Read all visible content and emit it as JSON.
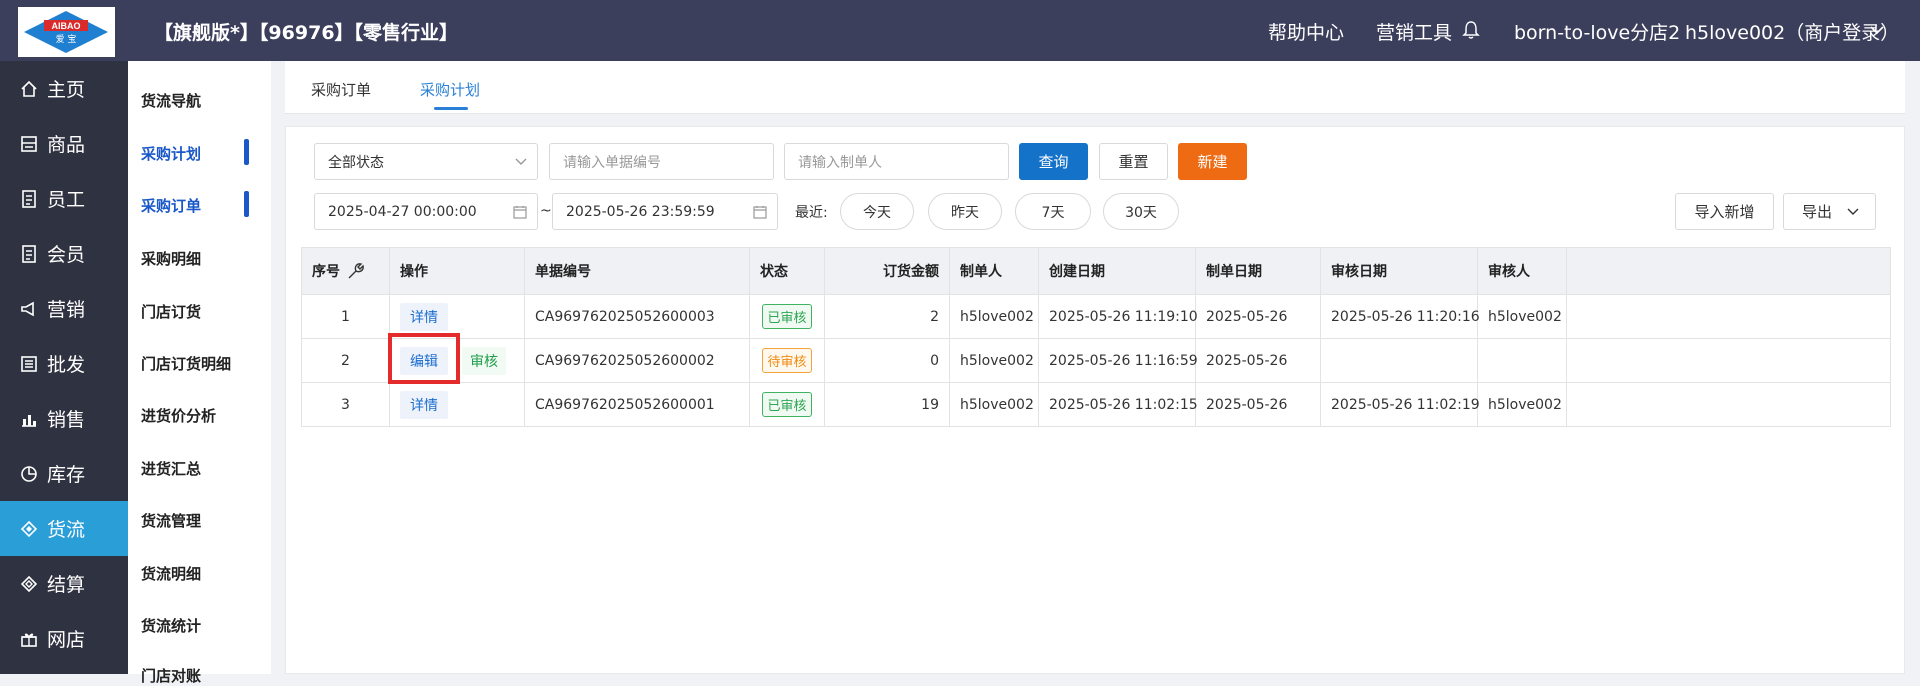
{
  "header": {
    "logo_text_top": "AIBAO",
    "logo_text_bottom": "爱 宝",
    "shop_title": "【旗舰版*】【96976】【零售行业】",
    "help": "帮助中心",
    "marketing_tools": "营销工具",
    "store": "born-to-love分店2",
    "user": "h5love002（商户登录）"
  },
  "sidebar": {
    "items": [
      {
        "label": "主页",
        "icon": "home-icon"
      },
      {
        "label": "商品",
        "icon": "goods-icon"
      },
      {
        "label": "员工",
        "icon": "staff-icon"
      },
      {
        "label": "会员",
        "icon": "member-icon"
      },
      {
        "label": "营销",
        "icon": "marketing-icon"
      },
      {
        "label": "批发",
        "icon": "wholesale-icon"
      },
      {
        "label": "销售",
        "icon": "sales-chart-icon"
      },
      {
        "label": "库存",
        "icon": "stock-pie-icon"
      },
      {
        "label": "货流",
        "icon": "logistics-icon"
      },
      {
        "label": "结算",
        "icon": "settlement-icon"
      },
      {
        "label": "网店",
        "icon": "gift-icon"
      }
    ],
    "active": "货流"
  },
  "subnav": {
    "items": [
      "货流导航",
      "采购计划",
      "采购订单",
      "采购明细",
      "门店订货",
      "门店订货明细",
      "进货价分析",
      "进货汇总",
      "货流管理",
      "货流明细",
      "货流统计",
      "门店对账"
    ],
    "highlighted": [
      "采购计划",
      "采购订单"
    ]
  },
  "tabs": [
    "采购订单",
    "采购计划"
  ],
  "active_tab": "采购计划",
  "filters": {
    "status_value": "全部状态",
    "order_no_placeholder": "请输入单据编号",
    "maker_placeholder": "请输入制单人",
    "query": "查询",
    "reset": "重置",
    "create": "新建",
    "start_date": "2025-04-27 00:00:00",
    "tilde": "~",
    "end_date": "2025-05-26 23:59:59",
    "recent_label": "最近:",
    "quick": [
      "今天",
      "昨天",
      "7天",
      "30天"
    ],
    "import": "导入新增",
    "export": "导出"
  },
  "table": {
    "headers": [
      "序号",
      "操作",
      "单据编号",
      "状态",
      "订货金额",
      "制单人",
      "创建日期",
      "制单日期",
      "审核日期",
      "审核人",
      ""
    ],
    "rows": [
      {
        "no": "1",
        "actions": [
          "详情"
        ],
        "order": "CA969762025052600003",
        "status": "已审核",
        "status_type": "ok",
        "amount": "2",
        "maker": "h5love002",
        "created": "2025-05-26 11:19:10",
        "made": "2025-05-26",
        "audited": "2025-05-26 11:20:16",
        "auditor": "h5love002"
      },
      {
        "no": "2",
        "actions": [
          "编辑",
          "审核"
        ],
        "order": "CA969762025052600002",
        "status": "待审核",
        "status_type": "wait",
        "amount": "0",
        "maker": "h5love002",
        "created": "2025-05-26 11:16:59",
        "made": "2025-05-26",
        "audited": "",
        "auditor": ""
      },
      {
        "no": "3",
        "actions": [
          "详情"
        ],
        "order": "CA969762025052600001",
        "status": "已审核",
        "status_type": "ok",
        "amount": "19",
        "maker": "h5love002",
        "created": "2025-05-26 11:02:15",
        "made": "2025-05-26",
        "audited": "2025-05-26 11:02:19",
        "auditor": "h5love002"
      }
    ]
  },
  "colors": {
    "header_bg": "#3c3f5c",
    "sidebar_bg": "#2f3240",
    "active_nav": "#2a9ed6",
    "primary": "#1572c9",
    "orange": "#ee6a13",
    "highlight_box": "#e42b2b"
  }
}
